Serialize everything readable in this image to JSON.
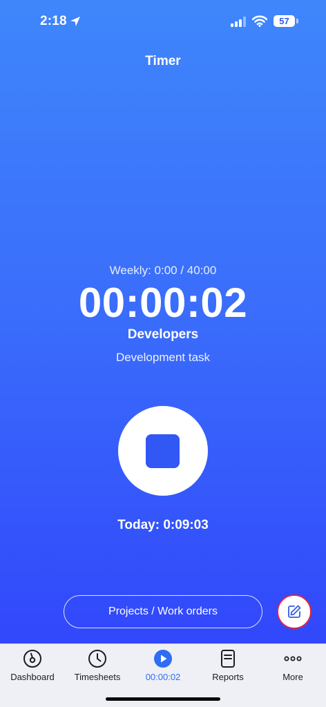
{
  "status_bar": {
    "time": "2:18",
    "battery": "57"
  },
  "header": {
    "title": "Timer"
  },
  "timer": {
    "weekly": "Weekly: 0:00 / 40:00",
    "elapsed": "00:00:02",
    "project": "Developers",
    "task": "Development task",
    "today": "Today: 0:09:03"
  },
  "actions": {
    "projects_label": "Projects / Work orders"
  },
  "tabs": [
    {
      "label": "Dashboard",
      "icon": "dashboard-gauge-icon"
    },
    {
      "label": "Timesheets",
      "icon": "clock-icon"
    },
    {
      "label": "00:00:02",
      "icon": "play-icon"
    },
    {
      "label": "Reports",
      "icon": "document-icon"
    },
    {
      "label": "More",
      "icon": "more-dots-icon"
    }
  ],
  "colors": {
    "accent": "#2f6df2",
    "gradient_top": "#3f86fb",
    "gradient_bottom": "#3147fb",
    "edit_border": "#e0254a"
  }
}
